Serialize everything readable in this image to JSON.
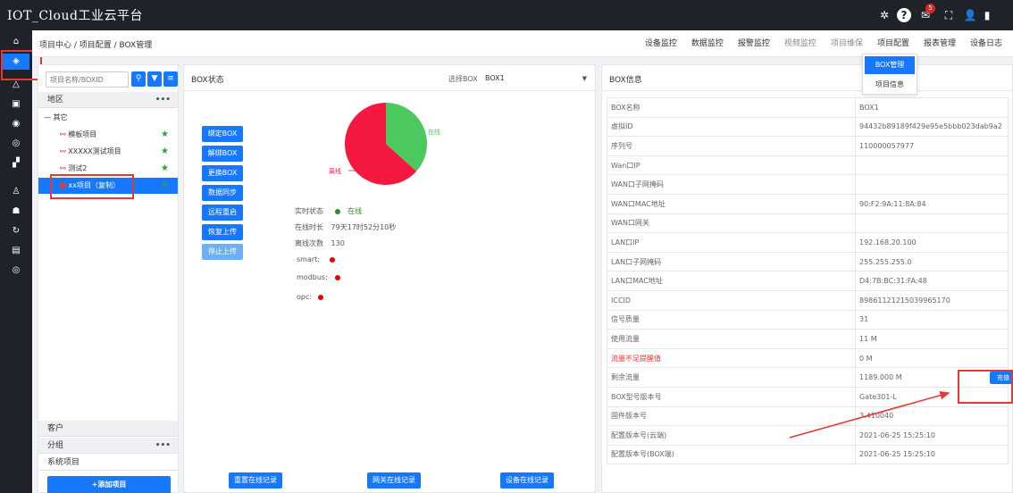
{
  "app": {
    "title": "IOT_Cloud工业云平台",
    "notification_count": "5"
  },
  "breadcrumb": "项目中心 / 项目配置 / BOX管理",
  "nav": [
    "设备监控",
    "数据监控",
    "报警监控",
    "视频监控",
    "项目维保",
    "项目配置",
    "报表管理",
    "设备日志"
  ],
  "dropdown": {
    "items": [
      "BOX管理",
      "项目信息"
    ]
  },
  "sidebar": {
    "search_placeholder": "项目名称/BOXID",
    "sections": {
      "region": "地区",
      "customer": "客户",
      "group": "分组",
      "system": "系统项目"
    },
    "tree": {
      "root": "— 其它",
      "items": [
        "模板项目",
        "XXXXX测试项目",
        "测试2",
        "xx项目（复制）"
      ]
    },
    "add_button": "+添加项目"
  },
  "box_status": {
    "title": "BOX状态",
    "select_label": "选择BOX",
    "selected_box": "BOX1",
    "buttons": [
      "绑定BOX",
      "解绑BOX",
      "更换BOX",
      "数据同步",
      "远程重启",
      "恢复上传",
      "停止上传"
    ],
    "pie": {
      "online_label": "在线",
      "offline_label": "离线",
      "colors": {
        "online": "#4cc95e",
        "offline": "#f5183f"
      }
    },
    "status": {
      "realtime_label": "实时状态",
      "realtime_value": "在线",
      "duration_label": "在线时长",
      "duration_value": "79天17时52分10秒",
      "offline_count_label": "离线次数",
      "offline_count_value": "130",
      "protocols": [
        "smart:",
        "modbus:",
        "opc:"
      ]
    },
    "record_buttons": [
      "重置在线记录",
      "网关在线记录",
      "设备在线记录"
    ]
  },
  "box_info": {
    "title": "BOX信息",
    "rows": [
      {
        "key": "BOX名称",
        "value": "BOX1"
      },
      {
        "key": "虚拟ID",
        "value": "94432b89189f429e95e5bbb023dab9a2"
      },
      {
        "key": "序列号",
        "value": "110000057977"
      },
      {
        "key": "Wan口IP",
        "value": ""
      },
      {
        "key": "WAN口子网掩码",
        "value": ""
      },
      {
        "key": "WAN口MAC地址",
        "value": "90:F2:9A:11:8A:84"
      },
      {
        "key": "WAN口网关",
        "value": ""
      },
      {
        "key": "LAN口IP",
        "value": "192.168.20.100"
      },
      {
        "key": "LAN口子网掩码",
        "value": "255.255.255.0"
      },
      {
        "key": "LAN口MAC地址",
        "value": "D4:7B:BC:31:FA:48"
      },
      {
        "key": "ICCID",
        "value": "89861121215039965170"
      },
      {
        "key": "信号质量",
        "value": "31"
      },
      {
        "key": "使用流量",
        "value": "11 M"
      },
      {
        "key": "流量不足提醒值",
        "value": "0  M"
      },
      {
        "key": "剩余流量",
        "value": "1189.000  M"
      },
      {
        "key": "BOX型号版本号",
        "value": "Gate301-L"
      },
      {
        "key": "固件版本号",
        "value": "3.410040"
      },
      {
        "key": "配置版本号(云端)",
        "value": "2021-06-25 15:25:10"
      },
      {
        "key": "配置版本号(BOX端)",
        "value": "2021-06-25 15:25:10"
      }
    ],
    "recharge_button": "充值"
  },
  "icons": {
    "topbar": [
      "settings-icon",
      "help-icon",
      "mail-icon",
      "fullscreen-icon",
      "user-icon"
    ],
    "sidebar": [
      "home-icon",
      "box-icon",
      "alarm-icon",
      "device-icon",
      "monitor-icon",
      "layers-icon",
      "report-icon",
      "user-icon",
      "people-icon",
      "refresh-icon",
      "list-icon",
      "layers-icon"
    ]
  }
}
